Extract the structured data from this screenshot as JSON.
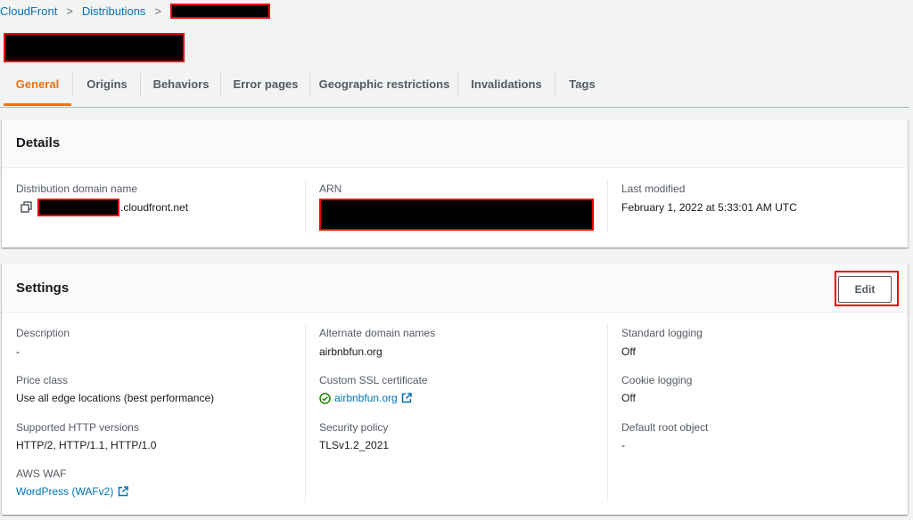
{
  "breadcrumb": {
    "root": "CloudFront",
    "parent": "Distributions",
    "separator": ">"
  },
  "tabs": [
    {
      "label": "General"
    },
    {
      "label": "Origins"
    },
    {
      "label": "Behaviors"
    },
    {
      "label": "Error pages"
    },
    {
      "label": "Geographic restrictions"
    },
    {
      "label": "Invalidations"
    },
    {
      "label": "Tags"
    }
  ],
  "details": {
    "title": "Details",
    "domain_label": "Distribution domain name",
    "domain_suffix": ".cloudfront.net",
    "arn_label": "ARN",
    "modified_label": "Last modified",
    "modified_value": "February 1, 2022 at 5:33:01 AM UTC"
  },
  "settings": {
    "title": "Settings",
    "edit_label": "Edit",
    "description_label": "Description",
    "description_value": "-",
    "price_label": "Price class",
    "price_value": "Use all edge locations (best performance)",
    "http_label": "Supported HTTP versions",
    "http_value": "HTTP/2, HTTP/1.1, HTTP/1.0",
    "waf_label": "AWS WAF",
    "waf_value": "WordPress (WAFv2)",
    "alt_label": "Alternate domain names",
    "alt_value": "airbnbfun.org",
    "ssl_label": "Custom SSL certificate",
    "ssl_value": "airbnbfun.org",
    "policy_label": "Security policy",
    "policy_value": "TLSv1.2_2021",
    "logging_label": "Standard logging",
    "logging_value": "Off",
    "cookie_label": "Cookie logging",
    "cookie_value": "Off",
    "root_label": "Default root object",
    "root_value": "-"
  },
  "colors": {
    "link": "#0073bb",
    "accent": "#ec7211",
    "success": "#1d8102",
    "redaction_border": "#e00000"
  }
}
